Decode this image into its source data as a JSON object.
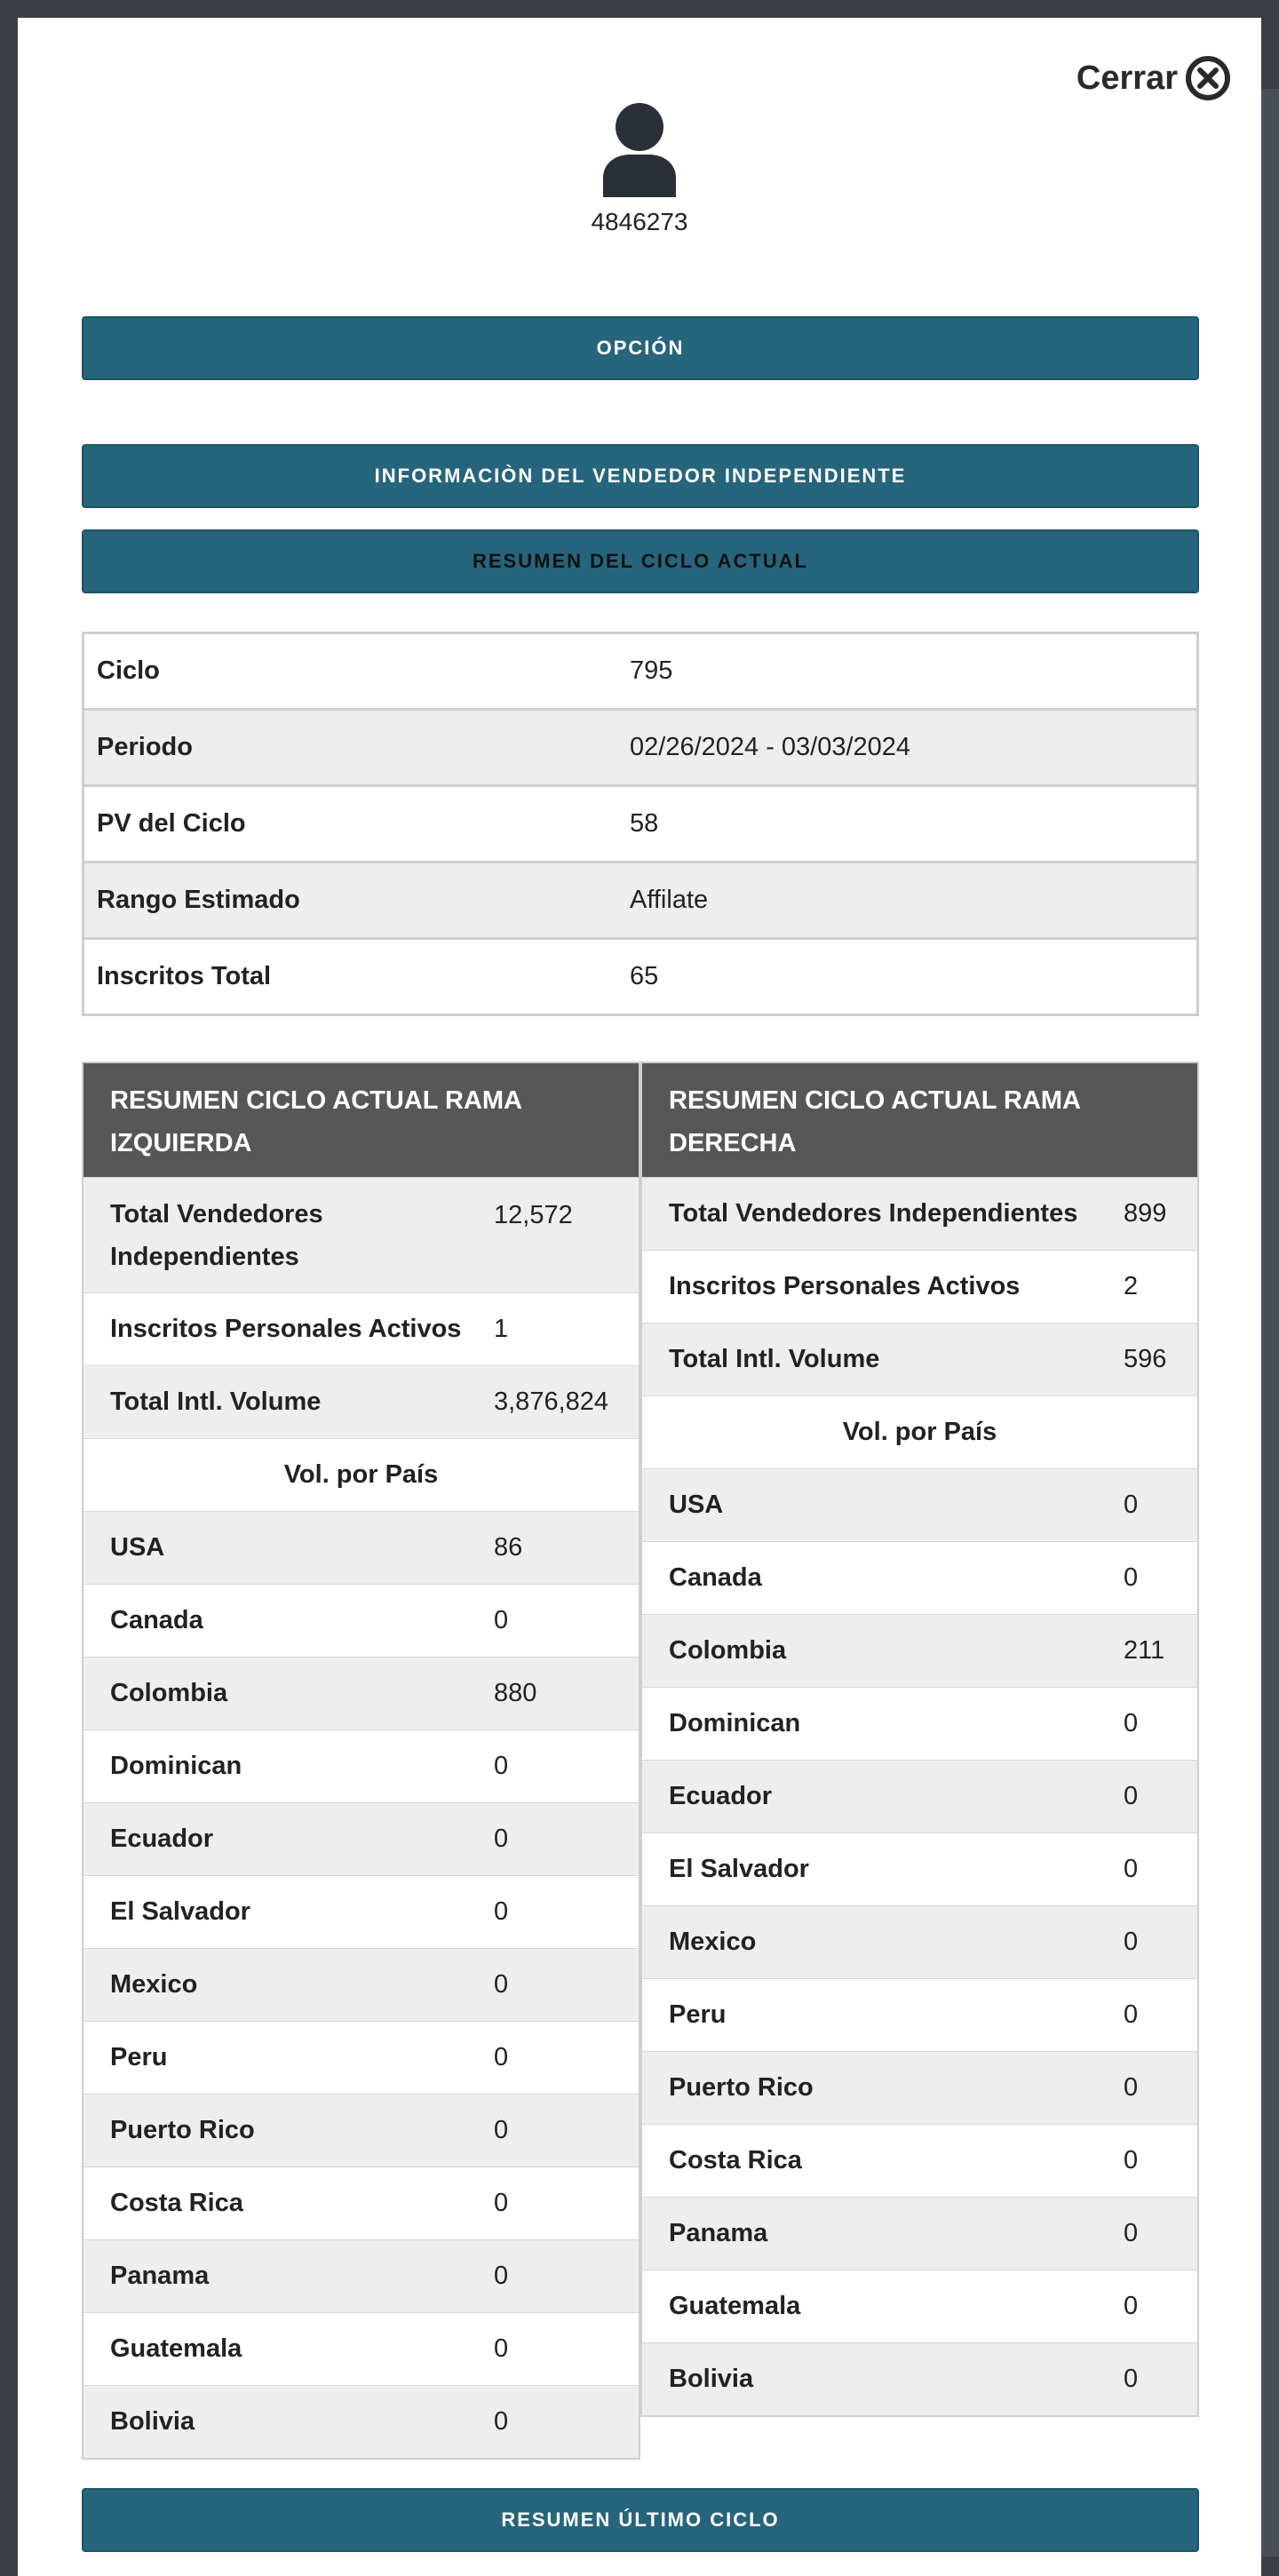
{
  "close": {
    "label": "Cerrar"
  },
  "profile": {
    "id": "4846273"
  },
  "buttons": {
    "option": "OPCIÓN",
    "vendor_info": "INFORMACIÒN DEL VENDEDOR INDEPENDIENTE",
    "current_cycle": "RESUMEN DEL CICLO ACTUAL",
    "last_cycle": "RESUMEN ÚLTIMO CICLO"
  },
  "summary": [
    {
      "label": "Ciclo",
      "value": "795"
    },
    {
      "label": "Periodo",
      "value": "02/26/2024 - 03/03/2024"
    },
    {
      "label": "PV del Ciclo",
      "value": "58"
    },
    {
      "label": "Rango Estimado",
      "value": "Affilate"
    },
    {
      "label": "Inscritos Total",
      "value": "65"
    }
  ],
  "left_branch": {
    "title": "RESUMEN CICLO ACTUAL RAMA IZQUIERDA",
    "total_vendors_label": "Total Vendedores Independientes",
    "total_vendors": "12,572",
    "active_label": "Inscritos Personales Activos",
    "active": "1",
    "volume_label": "Total Intl. Volume",
    "volume": "3,876,824",
    "by_country_label": "Vol. por País",
    "countries": [
      {
        "name": "USA",
        "value": "86"
      },
      {
        "name": "Canada",
        "value": "0"
      },
      {
        "name": "Colombia",
        "value": "880"
      },
      {
        "name": "Dominican",
        "value": "0"
      },
      {
        "name": "Ecuador",
        "value": "0"
      },
      {
        "name": "El Salvador",
        "value": "0"
      },
      {
        "name": "Mexico",
        "value": "0"
      },
      {
        "name": "Peru",
        "value": "0"
      },
      {
        "name": "Puerto Rico",
        "value": "0"
      },
      {
        "name": "Costa Rica",
        "value": "0"
      },
      {
        "name": "Panama",
        "value": "0"
      },
      {
        "name": "Guatemala",
        "value": "0"
      },
      {
        "name": "Bolivia",
        "value": "0"
      }
    ]
  },
  "right_branch": {
    "title": "RESUMEN CICLO ACTUAL RAMA DERECHA",
    "total_vendors_label": "Total Vendedores Independientes",
    "total_vendors": "899",
    "active_label": "Inscritos Personales Activos",
    "active": "2",
    "volume_label": "Total Intl. Volume",
    "volume": "596",
    "by_country_label": "Vol. por País",
    "countries": [
      {
        "name": "USA",
        "value": "0"
      },
      {
        "name": "Canada",
        "value": "0"
      },
      {
        "name": "Colombia",
        "value": "211"
      },
      {
        "name": "Dominican",
        "value": "0"
      },
      {
        "name": "Ecuador",
        "value": "0"
      },
      {
        "name": "El Salvador",
        "value": "0"
      },
      {
        "name": "Mexico",
        "value": "0"
      },
      {
        "name": "Peru",
        "value": "0"
      },
      {
        "name": "Puerto Rico",
        "value": "0"
      },
      {
        "name": "Costa Rica",
        "value": "0"
      },
      {
        "name": "Panama",
        "value": "0"
      },
      {
        "name": "Guatemala",
        "value": "0"
      },
      {
        "name": "Bolivia",
        "value": "0"
      }
    ]
  },
  "colors": {
    "button": "#26657c",
    "branch_header": "#575757",
    "row_alt": "#eeeeee",
    "overlay": "#3a3e44"
  }
}
